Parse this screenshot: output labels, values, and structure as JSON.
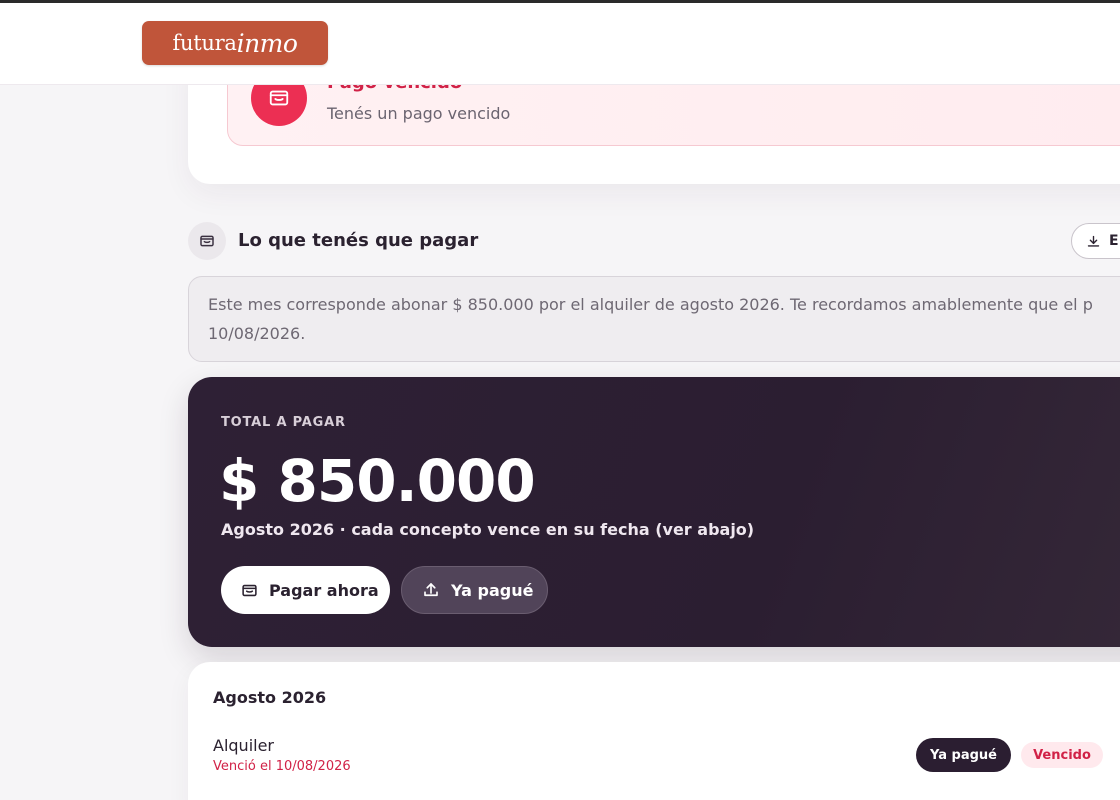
{
  "header": {
    "logo_part1": "futura",
    "logo_part2": "inmo",
    "brand_color": "#c0553a"
  },
  "alert": {
    "icon": "wallet-icon",
    "title": "Pago vencido",
    "message": "Tenés un pago vencido",
    "accent_color": "#ec2f53"
  },
  "payment_section": {
    "icon": "wallet-icon",
    "title": "Lo que tenés que pagar",
    "export_icon": "download-icon",
    "export_label": "E",
    "info_line1": "Este mes corresponde abonar $ 850.000 por el alquiler de agosto 2026. Te recordamos amablemente que el p",
    "info_line2": "10/08/2026."
  },
  "total": {
    "label": "TOTAL A PAGAR",
    "amount": "$ 850.000",
    "subtitle": "Agosto 2026 · cada concepto vence en su fecha (ver abajo)",
    "pay_now_label": "Pagar ahora",
    "already_paid_label": "Ya pagué",
    "card_color": "#2e2035"
  },
  "detail": {
    "month": "Agosto 2026",
    "items": [
      {
        "concept": "Alquiler",
        "due_text": "Venció el 10/08/2026",
        "action_label": "Ya pagué",
        "status": "Vencido",
        "status_color": "#d12247"
      }
    ]
  }
}
